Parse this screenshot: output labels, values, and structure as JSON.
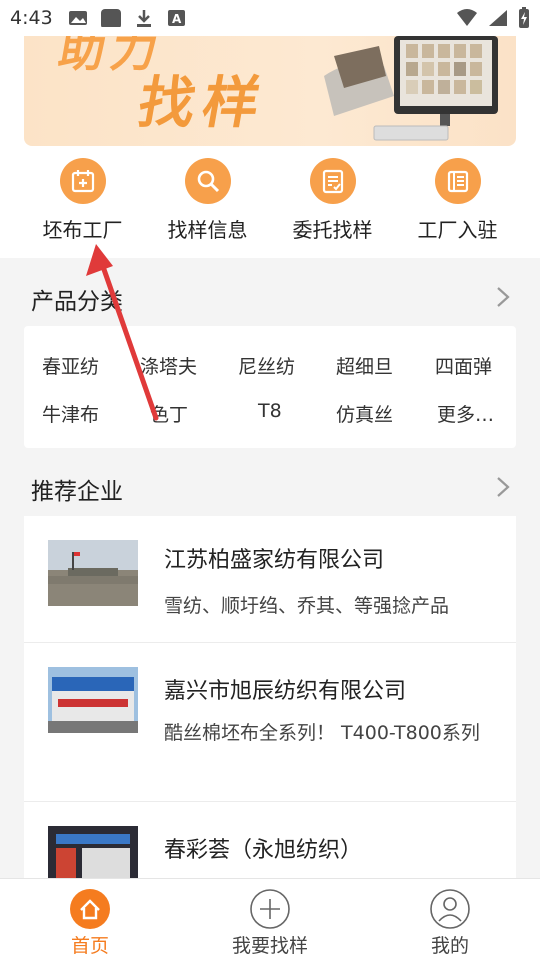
{
  "status_bar": {
    "time": "4:43"
  },
  "banner": {
    "text_line1": "助力",
    "text_line2": "找样"
  },
  "quick_entries": [
    {
      "label": "坯布工厂",
      "icon": "factory-calendar-icon"
    },
    {
      "label": "找样信息",
      "icon": "search-icon"
    },
    {
      "label": "委托找样",
      "icon": "document-check-icon"
    },
    {
      "label": "工厂入驻",
      "icon": "building-icon"
    }
  ],
  "categories": {
    "title": "产品分类",
    "items": [
      "春亚纺",
      "涤塔夫",
      "尼丝纺",
      "超细旦",
      "四面弹",
      "牛津布",
      "色丁",
      "T8",
      "仿真丝",
      "更多…"
    ]
  },
  "recommended": {
    "title": "推荐企业",
    "companies": [
      {
        "name": "江苏柏盛家纺有限公司",
        "desc": "雪纺、顺圩绉、乔其、等强捻产品"
      },
      {
        "name": "嘉兴市旭辰纺织有限公司",
        "desc": "酷丝棉坯布全系列！ T400-T800系列"
      },
      {
        "name": "春彩荟（永旭纺织）",
        "desc": ""
      }
    ]
  },
  "bottom_nav": [
    {
      "label": "首页",
      "active": true
    },
    {
      "label": "我要找样",
      "active": false
    },
    {
      "label": "我的",
      "active": false
    }
  ],
  "colors": {
    "accent": "#f7a04b",
    "active_nav": "#f57c1f",
    "annotation": "#e03a3a"
  }
}
